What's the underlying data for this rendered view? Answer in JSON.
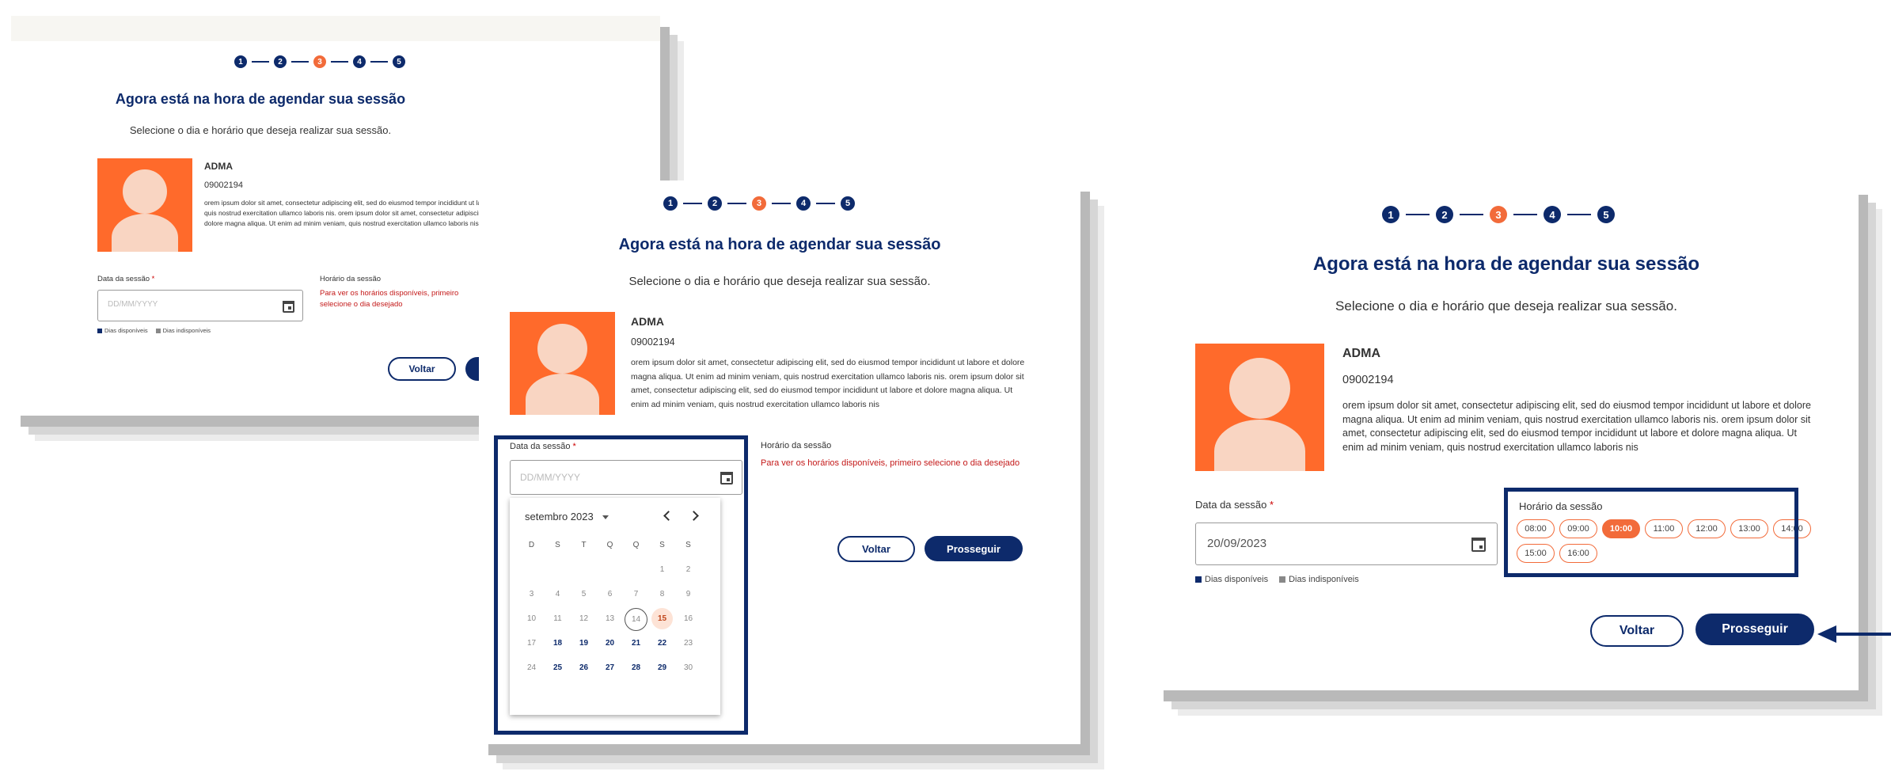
{
  "steps": [
    "1",
    "2",
    "3",
    "4",
    "5"
  ],
  "title": "Agora está na hora de agendar sua sessão",
  "subtitle": "Selecione o dia e horário que deseja realizar sua sessão.",
  "profile": {
    "name": "ADMA",
    "code": "09002194",
    "description": "orem ipsum dolor sit amet, consectetur adipiscing elit, sed do eiusmod tempor incididunt ut labore et dolore magna aliqua. Ut enim ad minim veniam, quis nostrud exercitation ullamco laboris nis. orem ipsum dolor sit amet, consectetur adipiscing elit, sed do eiusmod tempor incididunt ut labore et dolore magna aliqua. Ut enim ad minim veniam, quis nostrud exercitation ullamco laboris nis"
  },
  "form": {
    "date_label": "Data da sessão",
    "required_mark": "*",
    "date_placeholder": "DD/MM/YYYY",
    "date_value_filled": "20/09/2023",
    "time_label": "Horário da sessão",
    "time_hint": "Para ver os horários disponíveis, primeiro selecione o dia desejado",
    "legend_available": "Dias disponíveis",
    "legend_unavailable": "Dias indisponíveis"
  },
  "buttons": {
    "back": "Voltar",
    "next": "Prosseguir"
  },
  "calendar": {
    "month": "setembro 2023",
    "weekdays": [
      "D",
      "S",
      "T",
      "Q",
      "Q",
      "S",
      "S"
    ],
    "days": [
      {
        "d": "",
        "s": ""
      },
      {
        "d": "",
        "s": ""
      },
      {
        "d": "",
        "s": ""
      },
      {
        "d": "",
        "s": ""
      },
      {
        "d": "",
        "s": ""
      },
      {
        "d": "1",
        "s": ""
      },
      {
        "d": "2",
        "s": ""
      },
      {
        "d": "3",
        "s": ""
      },
      {
        "d": "4",
        "s": ""
      },
      {
        "d": "5",
        "s": ""
      },
      {
        "d": "6",
        "s": ""
      },
      {
        "d": "7",
        "s": ""
      },
      {
        "d": "8",
        "s": ""
      },
      {
        "d": "9",
        "s": ""
      },
      {
        "d": "10",
        "s": ""
      },
      {
        "d": "11",
        "s": ""
      },
      {
        "d": "12",
        "s": ""
      },
      {
        "d": "13",
        "s": ""
      },
      {
        "d": "14",
        "s": "today"
      },
      {
        "d": "15",
        "s": "sel"
      },
      {
        "d": "16",
        "s": ""
      },
      {
        "d": "17",
        "s": ""
      },
      {
        "d": "18",
        "s": "on"
      },
      {
        "d": "19",
        "s": "on"
      },
      {
        "d": "20",
        "s": "on"
      },
      {
        "d": "21",
        "s": "on"
      },
      {
        "d": "22",
        "s": "on"
      },
      {
        "d": "23",
        "s": ""
      },
      {
        "d": "24",
        "s": ""
      },
      {
        "d": "25",
        "s": "on"
      },
      {
        "d": "26",
        "s": "on"
      },
      {
        "d": "27",
        "s": "on"
      },
      {
        "d": "28",
        "s": "on"
      },
      {
        "d": "29",
        "s": "on"
      },
      {
        "d": "30",
        "s": ""
      }
    ]
  },
  "time_slots": [
    "08:00",
    "09:00",
    "10:00",
    "11:00",
    "12:00",
    "13:00",
    "14:00",
    "15:00",
    "16:00"
  ],
  "selected_slot": "10:00",
  "colors": {
    "navy": "#0d2a6b",
    "orange": "#f26b3a",
    "error": "#c41a1a",
    "avatar_bg": "#ff6a2b"
  }
}
